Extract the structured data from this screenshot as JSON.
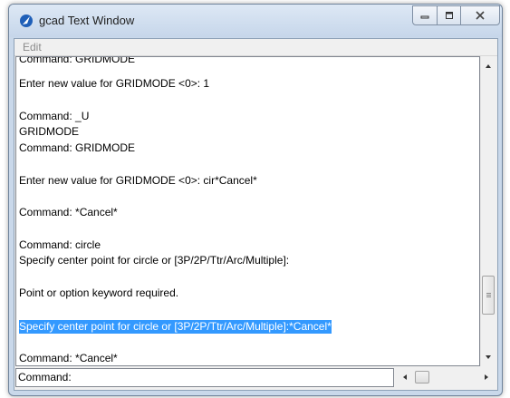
{
  "window": {
    "title": "gcad Text Window",
    "app_icon": "gcad-logo-icon",
    "controls": [
      "minimize-icon",
      "maximize-icon",
      "close-icon"
    ]
  },
  "menu": {
    "items": [
      {
        "label": "Edit"
      }
    ]
  },
  "history": {
    "lines": [
      {
        "text": "Command: GRIDMODE"
      },
      {
        "text": "Enter new value for GRIDMODE <0>: 1"
      },
      {
        "text": "Command: _U"
      },
      {
        "text": "GRIDMODE"
      },
      {
        "text": "Command: GRIDMODE"
      },
      {
        "text": "Enter new value for GRIDMODE <0>: cir*Cancel*"
      },
      {
        "text": "Command: *Cancel*"
      },
      {
        "text": "Command: circle"
      },
      {
        "text": "Specify center point for circle or [3P/2P/Ttr/Arc/Multiple]:"
      },
      {
        "text": "Point or option keyword required."
      },
      {
        "text": "Specify center point for circle or [3P/2P/Ttr/Arc/Multiple]:*Cancel*"
      },
      {
        "text": "Command: *Cancel*"
      }
    ],
    "selected_color": "#3399ff"
  },
  "command_line": {
    "label": "Command:",
    "value": ""
  }
}
